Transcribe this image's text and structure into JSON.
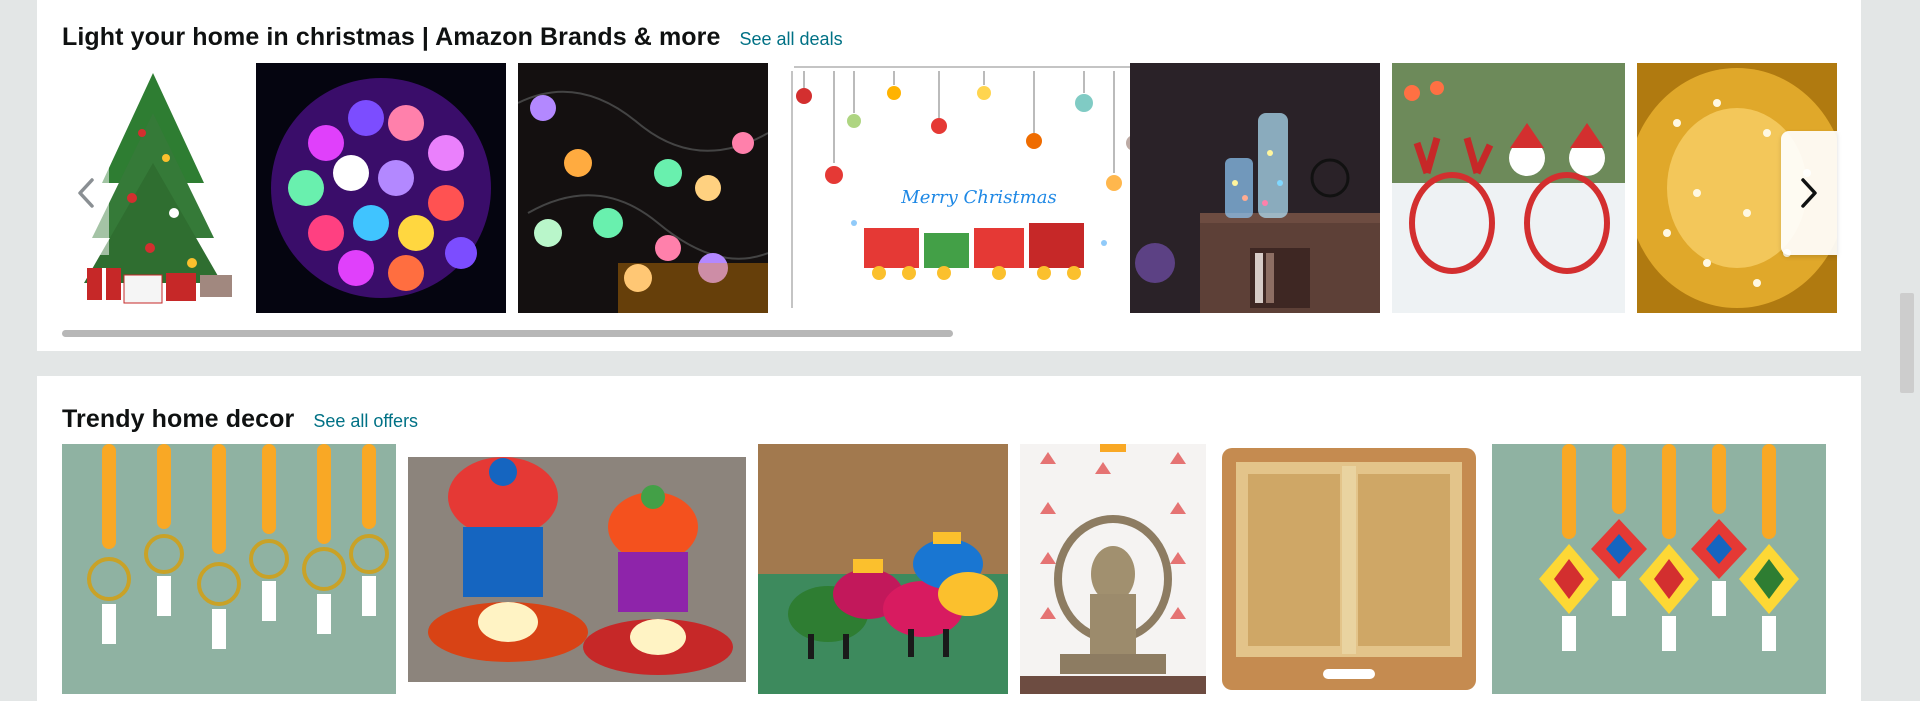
{
  "sections": [
    {
      "title": "Light your home in christmas | Amazon Brands & more",
      "link": "See all deals",
      "items": [
        {
          "icon": "christmas-tree"
        },
        {
          "icon": "led-ball-string-lights"
        },
        {
          "icon": "crystal-globe-lights"
        },
        {
          "icon": "christmas-wall-sticker",
          "sticker_text": "Merry Christmas"
        },
        {
          "icon": "bottle-fairy-lights"
        },
        {
          "icon": "reindeer-headbands"
        },
        {
          "icon": "warm-fairy-lights"
        }
      ]
    },
    {
      "title": "Trendy home decor",
      "link": "See all offers",
      "items": [
        {
          "icon": "marigold-toran-hangings"
        },
        {
          "icon": "rajasthani-tealight-holders"
        },
        {
          "icon": "elephant-tealight-holders"
        },
        {
          "icon": "lakshmi-idol-lotus-wall"
        },
        {
          "icon": "wicker-tray"
        },
        {
          "icon": "diamond-toran-hangings"
        }
      ]
    }
  ],
  "colors": {
    "page_bg": "#e3e6e6",
    "card_bg": "#ffffff",
    "title": "#0f1111",
    "link": "#007185"
  },
  "carousel": {
    "prev_icon": "chevron-left-icon",
    "next_icon": "chevron-right-icon"
  }
}
